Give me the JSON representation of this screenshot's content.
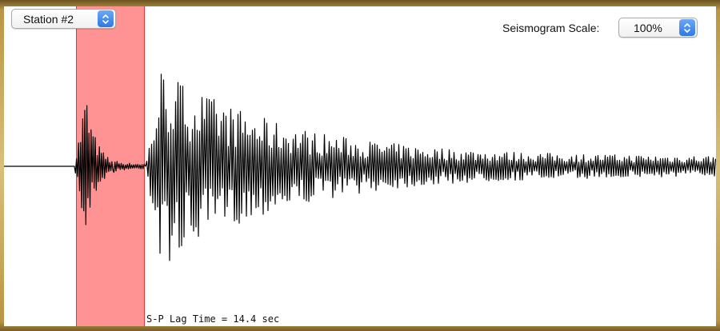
{
  "station_select": {
    "value": "Station #2"
  },
  "scale": {
    "label": "Seismogram Scale:",
    "value": "100%"
  },
  "sp_lag": {
    "text": "S-P Lag Time = 14.4 sec"
  },
  "colors": {
    "highlight": "#ff9393",
    "highlight_border": "#d83a3a",
    "trace": "#000000",
    "stepper": "#3b82f0"
  },
  "icons": {
    "stepper": "up-down-chevron-icon"
  }
}
